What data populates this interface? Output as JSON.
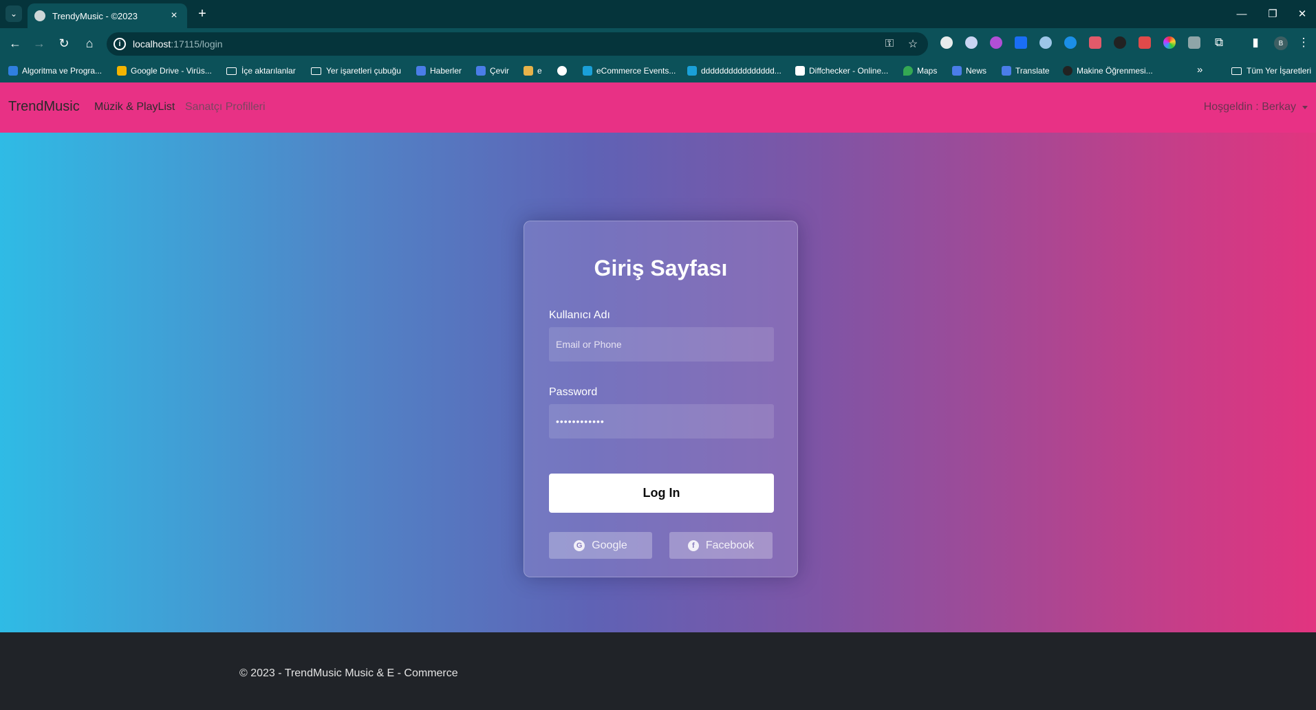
{
  "browser": {
    "tab_title": "TrendyMusic - ©2023",
    "url_host": "localhost",
    "url_path": ":17115/login",
    "bookmarks": [
      {
        "label": "Algoritma ve Progra...",
        "type": "site",
        "color": "#2f7fe0"
      },
      {
        "label": "Google Drive - Virüs...",
        "type": "site",
        "color": "#f4b400"
      },
      {
        "label": "İçe aktarılanlar",
        "type": "folder"
      },
      {
        "label": "Yer işaretleri çubuğu",
        "type": "folder"
      },
      {
        "label": "Haberler",
        "type": "site",
        "color": "#4a7de8"
      },
      {
        "label": "Çevir",
        "type": "site",
        "color": "#4a7de8"
      },
      {
        "label": "e",
        "type": "site",
        "color": "#e8b24a"
      },
      {
        "label": "",
        "type": "site",
        "color": "#ffffff"
      },
      {
        "label": "eCommerce Events...",
        "type": "site",
        "color": "#1aa0d8"
      },
      {
        "label": "dddddddddddddddd...",
        "type": "site",
        "color": "#1aa0d8"
      },
      {
        "label": "Diffchecker - Online...",
        "type": "site",
        "color": "#ffffff"
      },
      {
        "label": "Maps",
        "type": "site",
        "color": "#34a853"
      },
      {
        "label": "News",
        "type": "site",
        "color": "#4a7de8"
      },
      {
        "label": "Translate",
        "type": "site",
        "color": "#4a7de8"
      },
      {
        "label": "Makine Öğrenmesi...",
        "type": "site",
        "color": "#222222"
      }
    ],
    "all_bookmarks_label": "Tüm Yer İşaretleri",
    "profile_initial": "B"
  },
  "navbar": {
    "brand": "TrendMusic",
    "links": [
      "Müzik & PlayList",
      "Sanatçı Profilleri"
    ],
    "user_greeting": "Hoşgeldin : Berkay"
  },
  "login": {
    "title": "Giriş Sayfası",
    "username_label": "Kullanıcı Adı",
    "username_placeholder": "Email or Phone",
    "password_label": "Password",
    "password_value": "••••••••••••",
    "login_button": "Log In",
    "google_button": "Google",
    "facebook_button": "Facebook"
  },
  "footer": {
    "text": "© 2023 - TrendMusic Music & E - Commerce"
  },
  "colors": {
    "navbar": "#e83185",
    "gradient_start": "#2fbbe5",
    "gradient_end": "#e2347f",
    "browser_chrome": "#0c5159"
  }
}
